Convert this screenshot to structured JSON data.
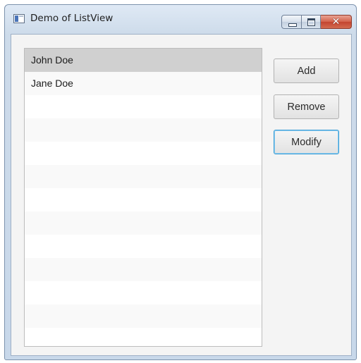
{
  "window": {
    "title": "Demo of ListView",
    "minimize_icon": "minimize-icon",
    "maximize_icon": "maximize-icon",
    "close_icon": "close-icon",
    "close_glyph": "✕"
  },
  "listview": {
    "items": [
      {
        "label": "John Doe",
        "selected": true
      },
      {
        "label": "Jane Doe",
        "selected": false
      }
    ],
    "empty_rows": 11
  },
  "buttons": {
    "add_label": "Add",
    "remove_label": "Remove",
    "modify_label": "Modify",
    "focused": "modify"
  },
  "colors": {
    "selection": "#d0d0d0",
    "focus_ring": "#3d9fd6",
    "close_button": "#c34430"
  }
}
